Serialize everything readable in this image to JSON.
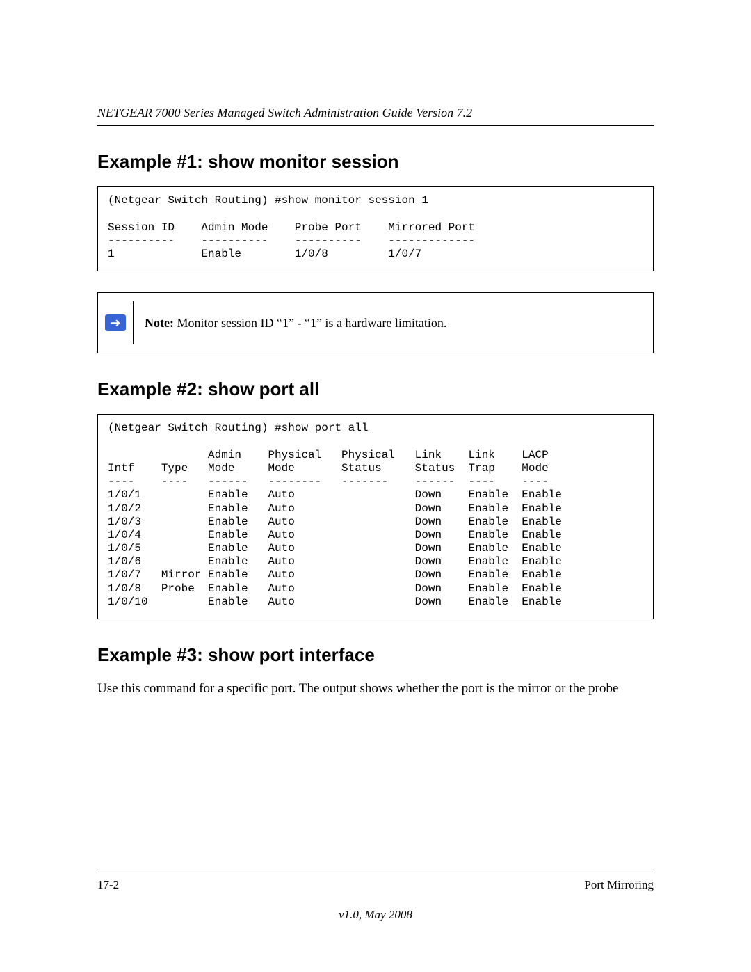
{
  "header": {
    "title": "NETGEAR 7000 Series Managed Switch Administration Guide Version 7.2"
  },
  "sections": {
    "ex1": {
      "heading": "Example #1: show monitor session",
      "cmdline": "(Netgear Switch Routing) #show monitor session 1",
      "cols": [
        "Session ID",
        "Admin Mode",
        "Probe Port",
        "Mirrored Port"
      ],
      "seps": [
        "----------",
        "----------",
        "----------",
        "-------------"
      ],
      "row": [
        "1",
        "Enable",
        "1/0/8",
        "1/0/7"
      ]
    },
    "note": {
      "label": "Note:",
      "text": " Monitor session ID “1” - “1” is a hardware limitation."
    },
    "ex2": {
      "heading": "Example #2: show port all",
      "cmdline": "(Netgear Switch Routing) #show port all",
      "head1": [
        "",
        "",
        "Admin",
        "Physical",
        "Physical",
        "Link",
        "Link",
        "LACP"
      ],
      "head2": [
        "Intf",
        "Type",
        "Mode",
        "Mode",
        "Status",
        "Status",
        "Trap",
        "Mode"
      ],
      "seps": [
        "----",
        "----",
        "------",
        "--------",
        "-------",
        "------",
        "----",
        "----"
      ],
      "rows": [
        [
          "1/0/1",
          "",
          "Enable",
          "Auto",
          "",
          "Down",
          "Enable",
          "Enable"
        ],
        [
          "1/0/2",
          "",
          "Enable",
          "Auto",
          "",
          "Down",
          "Enable",
          "Enable"
        ],
        [
          "1/0/3",
          "",
          "Enable",
          "Auto",
          "",
          "Down",
          "Enable",
          "Enable"
        ],
        [
          "1/0/4",
          "",
          "Enable",
          "Auto",
          "",
          "Down",
          "Enable",
          "Enable"
        ],
        [
          "1/0/5",
          "",
          "Enable",
          "Auto",
          "",
          "Down",
          "Enable",
          "Enable"
        ],
        [
          "1/0/6",
          "",
          "Enable",
          "Auto",
          "",
          "Down",
          "Enable",
          "Enable"
        ],
        [
          "1/0/7",
          "Mirror",
          "Enable",
          "Auto",
          "",
          "Down",
          "Enable",
          "Enable"
        ],
        [
          "1/0/8",
          "Probe",
          "Enable",
          "Auto",
          "",
          "Down",
          "Enable",
          "Enable"
        ],
        [
          "1/0/10",
          "",
          "Enable",
          "Auto",
          "",
          "Down",
          "Enable",
          "Enable"
        ]
      ]
    },
    "ex3": {
      "heading": "Example #3: show port interface",
      "body": "Use this command for a specific port. The output shows whether the port is the mirror or the probe"
    }
  },
  "footer": {
    "left": "17-2",
    "right": "Port Mirroring",
    "version": "v1.0, May 2008"
  }
}
